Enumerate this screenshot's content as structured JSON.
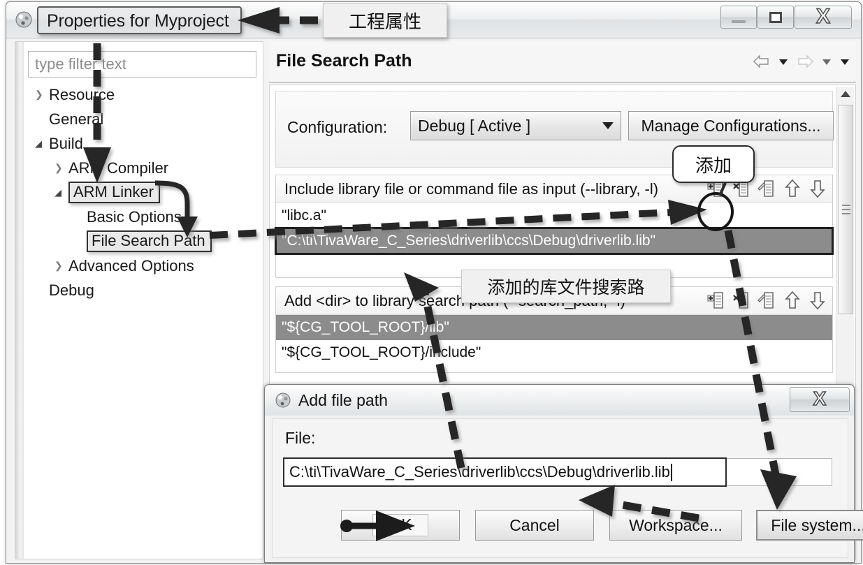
{
  "window": {
    "title": "Properties for Myproject",
    "icon": "ccs-app-icon",
    "buttons": {
      "minimize": "—",
      "maximize": "□",
      "close": "X"
    }
  },
  "tree": {
    "filter_placeholder": "type filter text",
    "items": [
      {
        "label": "Resource",
        "indent": 1,
        "marker": "collapsed",
        "highlight": false
      },
      {
        "label": "General",
        "indent": 1,
        "marker": "none",
        "highlight": false
      },
      {
        "label": "Build",
        "indent": 1,
        "marker": "expanded",
        "highlight": false
      },
      {
        "label": "ARM Compiler",
        "indent": 2,
        "marker": "collapsed",
        "highlight": false
      },
      {
        "label": "ARM Linker",
        "indent": 2,
        "marker": "expanded",
        "highlight": true
      },
      {
        "label": "Basic Options",
        "indent": 3,
        "marker": "none",
        "highlight": false
      },
      {
        "label": "File Search Path",
        "indent": 3,
        "marker": "none",
        "highlight": true
      },
      {
        "label": "Advanced Options",
        "indent": 2,
        "marker": "collapsed",
        "highlight": false
      },
      {
        "label": "Debug",
        "indent": 1,
        "marker": "none",
        "highlight": false
      }
    ]
  },
  "content": {
    "page_title": "File Search Path",
    "nav_icons": [
      "back-arrow-icon",
      "back-dropdown-icon",
      "forward-arrow-icon",
      "forward-dropdown-icon",
      "view-menu-icon"
    ],
    "configuration": {
      "label": "Configuration:",
      "value": "Debug  [ Active ]",
      "manage_button": "Manage Configurations..."
    },
    "library_section": {
      "header": "Include library file or command file as input (--library, -l)",
      "tools": [
        "add-icon",
        "delete-icon",
        "edit-icon",
        "move-up-icon",
        "move-down-icon"
      ],
      "rows": [
        {
          "text": "\"libc.a\"",
          "selected": false
        },
        {
          "text": "\"C:\\ti\\TivaWare_C_Series\\driverlib\\ccs\\Debug\\driverlib.lib\"",
          "selected": true
        }
      ]
    },
    "search_path_section": {
      "header": "Add <dir> to library search path (--search_path, -i)",
      "tools": [
        "add-icon",
        "delete-icon",
        "edit-icon",
        "move-up-icon",
        "move-down-icon"
      ],
      "rows": [
        {
          "text": "\"${CG_TOOL_ROOT}/lib\"",
          "selected": true
        },
        {
          "text": "\"${CG_TOOL_ROOT}/include\"",
          "selected": false
        }
      ]
    }
  },
  "dialog": {
    "title": "Add file path",
    "icon": "ccs-app-icon",
    "close_label": "X",
    "file_label": "File:",
    "file_value": "C:\\ti\\TivaWare_C_Series\\driverlib\\ccs\\Debug\\driverlib.lib",
    "buttons": {
      "ok": "OK",
      "cancel": "Cancel",
      "workspace": "Workspace...",
      "filesystem": "File system..."
    }
  },
  "annotations": {
    "title_note": "工程属性",
    "add_note": "添加",
    "library_note": "添加的库文件搜索路"
  },
  "colors": {
    "selection": "#8c8c8c",
    "annotation_stroke": "#262626",
    "window_chrome": "#e8eaec"
  }
}
